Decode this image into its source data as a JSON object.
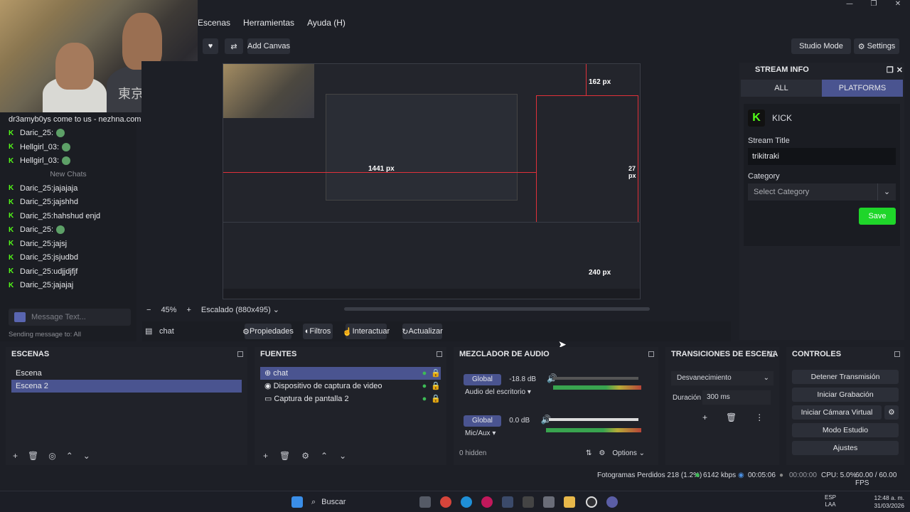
{
  "menu": [
    "Escenas",
    "Herramientas",
    "Ayuda (H)"
  ],
  "toolbar": {
    "add_canvas": "Add Canvas",
    "studio_mode": "Studio Mode",
    "settings": "Settings"
  },
  "chat": {
    "top_line": "dr3amyb0ys come to us - nezhna.com",
    "rows_top": [
      {
        "user": "Daric_25",
        "msg": ""
      },
      {
        "user": "Hellgirl_03",
        "msg": ""
      },
      {
        "user": "Hellgirl_03",
        "msg": ""
      }
    ],
    "new_chats_label": "New Chats",
    "rows": [
      {
        "user": "Daric_25",
        "msg": "jajajaja"
      },
      {
        "user": "Daric_25",
        "msg": "jajshhd"
      },
      {
        "user": "Daric_25",
        "msg": "hahshud enjd"
      },
      {
        "user": "Daric_25",
        "msg": ""
      },
      {
        "user": "Daric_25",
        "msg": "jajsj"
      },
      {
        "user": "Daric_25",
        "msg": "jsjudbd"
      },
      {
        "user": "Daric_25",
        "msg": "udjjdjfjf"
      },
      {
        "user": "Daric_25",
        "msg": "jajajaj"
      }
    ],
    "placeholder": "Message Text...",
    "hint": "Sending message to: All"
  },
  "preview": {
    "zoom": "45%",
    "scale": "Escalado (880x495)",
    "dim_labels": [
      "162 px",
      "1441 px",
      "27 px",
      "240 px"
    ]
  },
  "source_bar": {
    "name": "chat",
    "buttons": [
      "Propiedades",
      "Filtros",
      "Interactuar",
      "Actualizar"
    ]
  },
  "stream_info": {
    "title": "STREAM INFO",
    "tabs": [
      "ALL",
      "PLATFORMS"
    ],
    "platform": "KICK",
    "stream_title_label": "Stream Title",
    "stream_title_value": "trikitraki",
    "category_label": "Category",
    "category_placeholder": "Select Category",
    "save": "Save"
  },
  "docks": {
    "escenas": {
      "title": "ESCENAS",
      "items": [
        "Escena",
        "Escena 2"
      ]
    },
    "fuentes": {
      "title": "FUENTES",
      "items": [
        "chat",
        "Dispositivo de captura de video",
        "Captura de pantalla 2"
      ]
    },
    "mixer": {
      "title": "MEZCLADOR DE AUDIO",
      "channels": [
        {
          "btn": "Global",
          "db": "-18.8 dB",
          "name": "Audio del escritorio"
        },
        {
          "btn": "Global",
          "db": "0.0 dB",
          "name": "Mic/Aux"
        }
      ],
      "hidden": "0 hidden",
      "options": "Options"
    },
    "transiciones": {
      "title": "TRANSICIONES DE ESCENA",
      "type": "Desvanecimiento",
      "dur_label": "Duración",
      "dur_value": "300 ms"
    },
    "controles": {
      "title": "CONTROLES",
      "buttons": [
        "Detener Transmisión",
        "Iniciar Grabación",
        "Iniciar Cámara Virtual",
        "Modo Estudio",
        "Ajustes"
      ]
    }
  },
  "status": {
    "frames": "Fotogramas Perdidos 218 (1.2%)",
    "kbps": "6142 kbps",
    "stream_time": "00:05:06",
    "rec_time": "00:00:00",
    "cpu": "CPU: 5.0%",
    "fps": "60.00 / 60.00 FPS"
  },
  "taskbar": {
    "search": "Buscar",
    "lang1": "ESP",
    "lang2": "LAA",
    "time": "12:48 a. m.",
    "date": "31/03/2026"
  },
  "colors": {
    "accent": "#4a5490",
    "kick_green": "#53fc18",
    "save_green": "#1fd62a",
    "rec_red": "#e23b3b"
  }
}
